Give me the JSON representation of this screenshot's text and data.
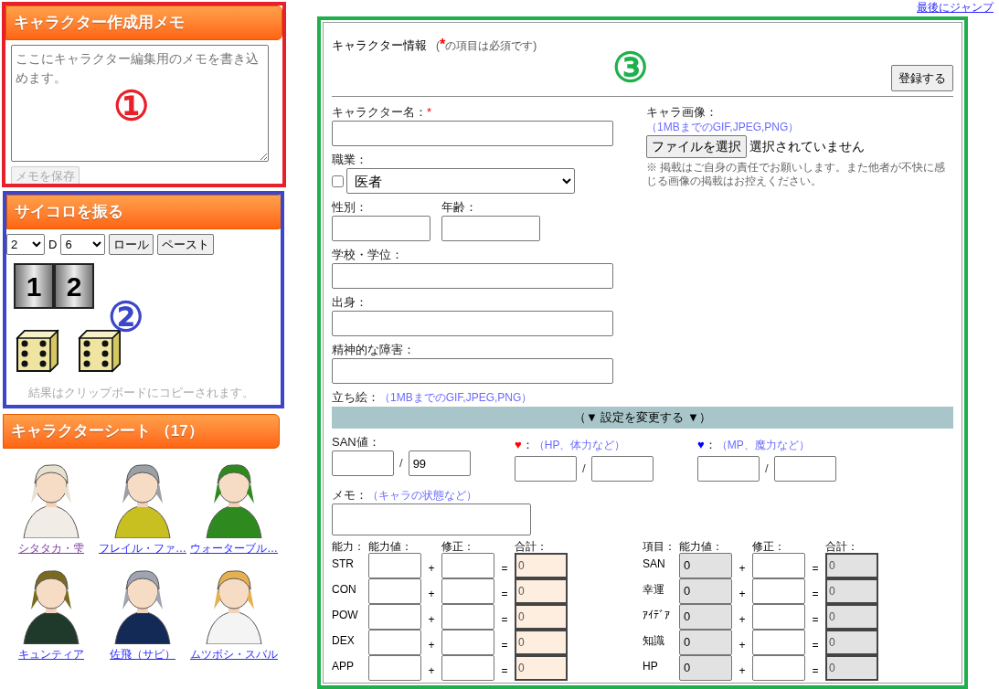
{
  "annotations": [
    {
      "label": "①",
      "color": "#e8202a"
    },
    {
      "label": "②",
      "color": "#3c46c8"
    },
    {
      "label": "③",
      "color": "#1fb04c"
    }
  ],
  "memo": {
    "title": "キャラクター作成用メモ",
    "placeholder": "ここにキャラクター編集用のメモを書き込めます。",
    "save_button": {
      "label": "メモを保存",
      "disabled": true
    }
  },
  "dice": {
    "title": "サイコロを振る",
    "count": "2",
    "d_label": "D",
    "sides": "6",
    "roll_button": "ロール",
    "paste_button": "ペースト",
    "counter": [
      "1",
      "2"
    ],
    "note": "結果はクリップボードにコピーされます。"
  },
  "character_sheets": {
    "title": "キャラクターシート （17）",
    "items": [
      {
        "name": "シタタカ・雫",
        "visited": true,
        "kind": "picture"
      },
      {
        "name": "フレイル・ファ…",
        "visited": false,
        "kind": "picture"
      },
      {
        "name": "ウォーターブル…",
        "visited": false,
        "kind": "picture"
      },
      {
        "name": "キュンティア",
        "visited": false,
        "kind": "picture"
      },
      {
        "name": "佐飛（サビ）",
        "visited": false,
        "kind": "picture"
      },
      {
        "name": "ムツボシ・スバル",
        "visited": false,
        "kind": "picture"
      }
    ]
  },
  "jump_link": "最後にジャンプ",
  "form": {
    "title": "キャラクター情報",
    "required_note": {
      "open": "(",
      "mark": "*",
      "text": "の項目は必須です)"
    },
    "submit_button": "登録する",
    "name": {
      "label": "キャラクター名：",
      "required": true
    },
    "job": {
      "label": "職業：",
      "checked": false,
      "value": "医者"
    },
    "sex": {
      "label": "性別："
    },
    "age": {
      "label": "年齢："
    },
    "school": {
      "label": "学校・学位："
    },
    "origin": {
      "label": "出身："
    },
    "disorder": {
      "label": "精神的な障害："
    },
    "standing_picture": {
      "label": "立ち絵：",
      "hint": "（1MBまでのGIF,JPEG,PNG）"
    },
    "image": {
      "label": "キャラ画像：",
      "hint": "（1MBまでのGIF,JPEG,PNG）",
      "file_button": "ファイルを選択",
      "file_status": "選択されていません",
      "note": "※ 掲載はご自身の責任でお願いします。また他者が不快に感じる画像の掲載はお控えください。"
    },
    "settings_bar": "（▼ 設定を変更する ▼）",
    "gauges": [
      {
        "kind": "text",
        "label": "SAN値：",
        "slash": "/",
        "max": "99"
      },
      {
        "kind": "heart",
        "label": "♥",
        "color": "#ff0000",
        "colon": "：",
        "hint": "（HP、体力など）",
        "slash": "/"
      },
      {
        "kind": "heart",
        "label": "♥",
        "color": "#0000ff",
        "colon": "：",
        "hint": "（MP、魔力など）",
        "slash": "/"
      }
    ],
    "status_memo": {
      "label": "メモ：",
      "hint": "（キャラの状態など）"
    },
    "tables": [
      {
        "kind": "ability",
        "headers": [
          "能力：",
          "能力値：",
          "修正：",
          "合計："
        ],
        "rows": [
          {
            "label": "STR",
            "value": "",
            "plus": "+",
            "equals": "=",
            "total": "0"
          },
          {
            "label": "CON",
            "value": "",
            "plus": "+",
            "equals": "=",
            "total": "0"
          },
          {
            "label": "POW",
            "value": "",
            "plus": "+",
            "equals": "=",
            "total": "0"
          },
          {
            "label": "DEX",
            "value": "",
            "plus": "+",
            "equals": "=",
            "total": "0"
          },
          {
            "label": "APP",
            "value": "",
            "plus": "+",
            "equals": "=",
            "total": "0"
          }
        ]
      },
      {
        "kind": "derived",
        "headers": [
          "項目：",
          "能力値：",
          "修正：",
          "合計："
        ],
        "rows": [
          {
            "label": "SAN",
            "value": "0",
            "plus": "+",
            "equals": "=",
            "total": "0"
          },
          {
            "label": "幸運",
            "value": "0",
            "plus": "+",
            "equals": "=",
            "total": "0"
          },
          {
            "label": "ｱｲﾃﾞｱ",
            "value": "0",
            "plus": "+",
            "equals": "=",
            "total": "0"
          },
          {
            "label": "知識",
            "value": "0",
            "plus": "+",
            "equals": "=",
            "total": "0"
          },
          {
            "label": "HP",
            "value": "0",
            "plus": "+",
            "equals": "=",
            "total": "0"
          }
        ]
      }
    ]
  }
}
